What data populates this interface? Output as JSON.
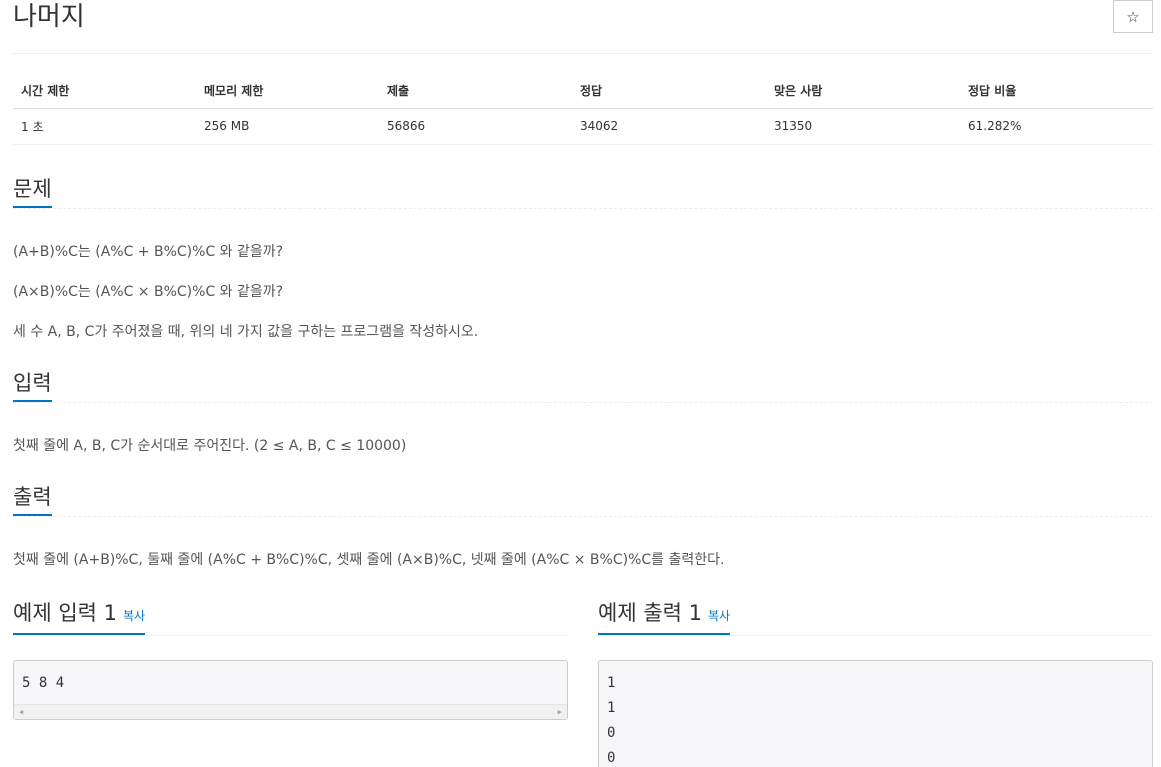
{
  "title": "나머지",
  "star_icon": "☆",
  "info_table": {
    "headers": [
      "시간 제한",
      "메모리 제한",
      "제출",
      "정답",
      "맞은 사람",
      "정답 비율"
    ],
    "row": [
      "1 초",
      "256 MB",
      "56866",
      "34062",
      "31350",
      "61.282%"
    ]
  },
  "problem": {
    "heading": "문제",
    "lines": [
      "(A+B)%C는 (A%C + B%C)%C 와 같을까?",
      "(A×B)%C는 (A%C × B%C)%C 와 같을까?",
      "세 수 A, B, C가 주어졌을 때, 위의 네 가지 값을 구하는 프로그램을 작성하시오."
    ]
  },
  "input": {
    "heading": "입력",
    "text": "첫째 줄에 A, B, C가 순서대로 주어진다. (2 ≤ A, B, C ≤ 10000)"
  },
  "output": {
    "heading": "출력",
    "text": "첫째 줄에 (A+B)%C, 둘째 줄에 (A%C + B%C)%C, 셋째 줄에 (A×B)%C, 넷째 줄에 (A%C × B%C)%C를 출력한다."
  },
  "sample_input": {
    "heading": "예제 입력 1",
    "copy_label": "복사",
    "content": "5 8 4"
  },
  "sample_output": {
    "heading": "예제 출력 1",
    "copy_label": "복사",
    "content": "1\n1\n0\n0"
  },
  "accent_color": "#0076c0"
}
